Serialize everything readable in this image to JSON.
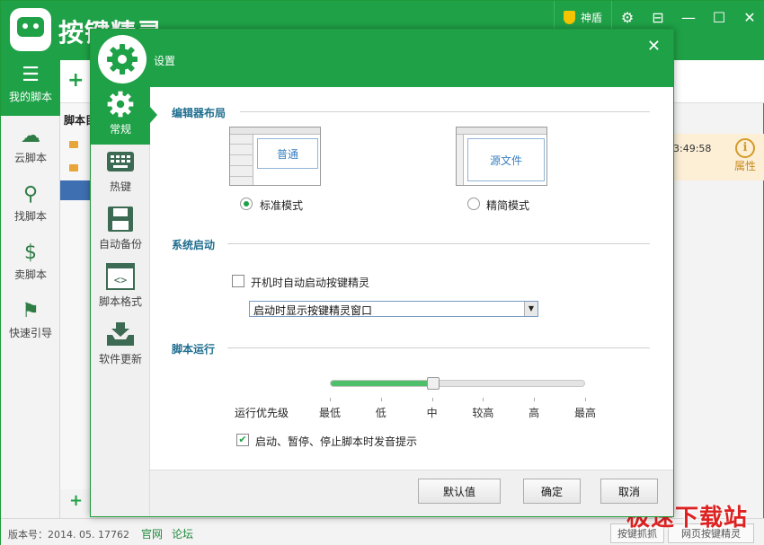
{
  "app": {
    "title": "按键精灵",
    "shield_label": "神盾",
    "sidebar": [
      {
        "label": "我的脚本"
      },
      {
        "label": "云脚本"
      },
      {
        "label": "找脚本"
      },
      {
        "label": "卖脚本"
      },
      {
        "label": "快速引导"
      }
    ],
    "tree_header": "脚本目",
    "time_fragment": "3:49:58",
    "property_label": "属性",
    "status": {
      "version": "版本号：2014. 05. 17762",
      "link_official": "官网",
      "link_forum": "论坛",
      "btn_left": "按键抓抓",
      "btn_right": "网页按键精灵"
    },
    "watermark": "极速下载站"
  },
  "dialog": {
    "title": "设置",
    "nav": [
      {
        "label": "常规",
        "icon": "gear-icon"
      },
      {
        "label": "热键",
        "icon": "keyboard-icon"
      },
      {
        "label": "自动备份",
        "icon": "floppy-disk-icon"
      },
      {
        "label": "脚本格式",
        "icon": "code-icon"
      },
      {
        "label": "软件更新",
        "icon": "download-tray-icon"
      }
    ],
    "editor_layout": {
      "heading": "编辑器布局",
      "standard_preview": "普通",
      "simple_preview": "源文件",
      "standard_label": "标准模式",
      "simple_label": "精简模式",
      "selected": "standard"
    },
    "startup": {
      "heading": "系统启动",
      "autostart_label": "开机时自动启动按键精灵",
      "autostart_checked": false,
      "window_option": "启动时显示按键精灵窗口"
    },
    "run": {
      "heading": "脚本运行",
      "priority_label": "运行优先级",
      "levels": [
        "最低",
        "低",
        "中",
        "较高",
        "高",
        "最高"
      ],
      "selected_level": "中",
      "sound_label": "启动、暂停、停止脚本时发音提示",
      "sound_checked": true
    },
    "buttons": {
      "default": "默认值",
      "ok": "确定",
      "cancel": "取消"
    }
  },
  "colors": {
    "brand_green": "#1fa147",
    "section_blue": "#1f6e8f"
  }
}
